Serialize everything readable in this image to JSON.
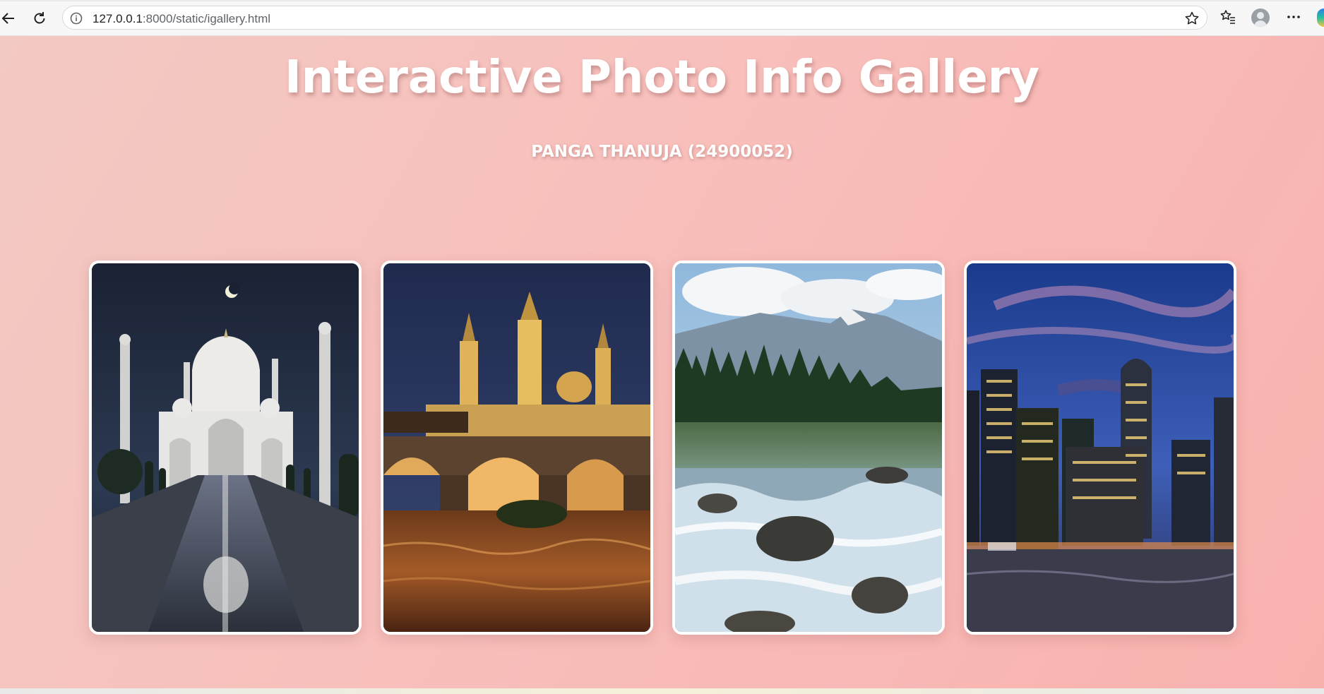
{
  "browser": {
    "url_host": "127.0.0.1",
    "url_path": ":8000/static/igallery.html",
    "icons": [
      "back-icon",
      "reload-icon",
      "info-icon",
      "star-icon",
      "favorites-icon",
      "profile-icon",
      "more-icon"
    ]
  },
  "page": {
    "title": "Interactive Photo Info Gallery",
    "subtitle": "PANGA THANUJA (24900052)"
  },
  "gallery": {
    "photos": [
      {
        "subject": "taj-mahal-night"
      },
      {
        "subject": "basilica-bridge-night"
      },
      {
        "subject": "mountain-river-forest"
      },
      {
        "subject": "city-skyline-dusk"
      }
    ]
  },
  "colors": {
    "background_start": "#f3c9c3",
    "background_end": "#f9b1ae",
    "title_text": "#ffffff",
    "card_border": "#ffffff"
  }
}
